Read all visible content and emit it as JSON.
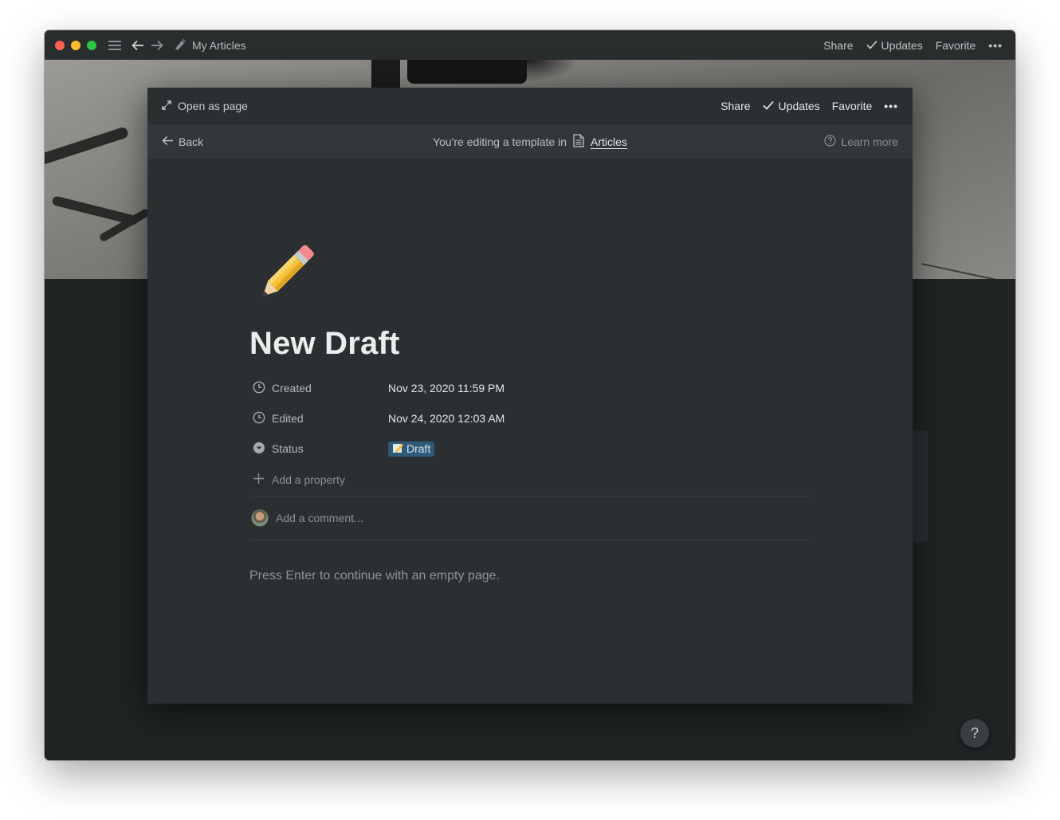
{
  "titlebar": {
    "title": "My Articles",
    "share": "Share",
    "updates": "Updates",
    "favorite": "Favorite"
  },
  "modal": {
    "open_as_page": "Open as page",
    "share": "Share",
    "updates": "Updates",
    "favorite": "Favorite"
  },
  "banner": {
    "back": "Back",
    "editing_text": "You're editing a template in",
    "database_link": "Articles",
    "learn_more": "Learn more"
  },
  "page": {
    "icon": "pencil-emoji",
    "title": "New Draft",
    "properties": [
      {
        "name": "Created",
        "value": "Nov 23, 2020 11:59 PM",
        "icon": "clock-icon"
      },
      {
        "name": "Edited",
        "value": "Nov 24, 2020 12:03 AM",
        "icon": "clock-icon"
      },
      {
        "name": "Status",
        "value": "Draft",
        "icon": "select-icon"
      }
    ],
    "add_property": "Add a property",
    "comment_placeholder": "Add a comment...",
    "empty_hint": "Press Enter to continue with an empty page."
  },
  "help": {
    "label": "?"
  },
  "colors": {
    "background": "#2b2f31",
    "status_badge": "#2f5a7a",
    "titlebar": "#2a2d2e"
  }
}
